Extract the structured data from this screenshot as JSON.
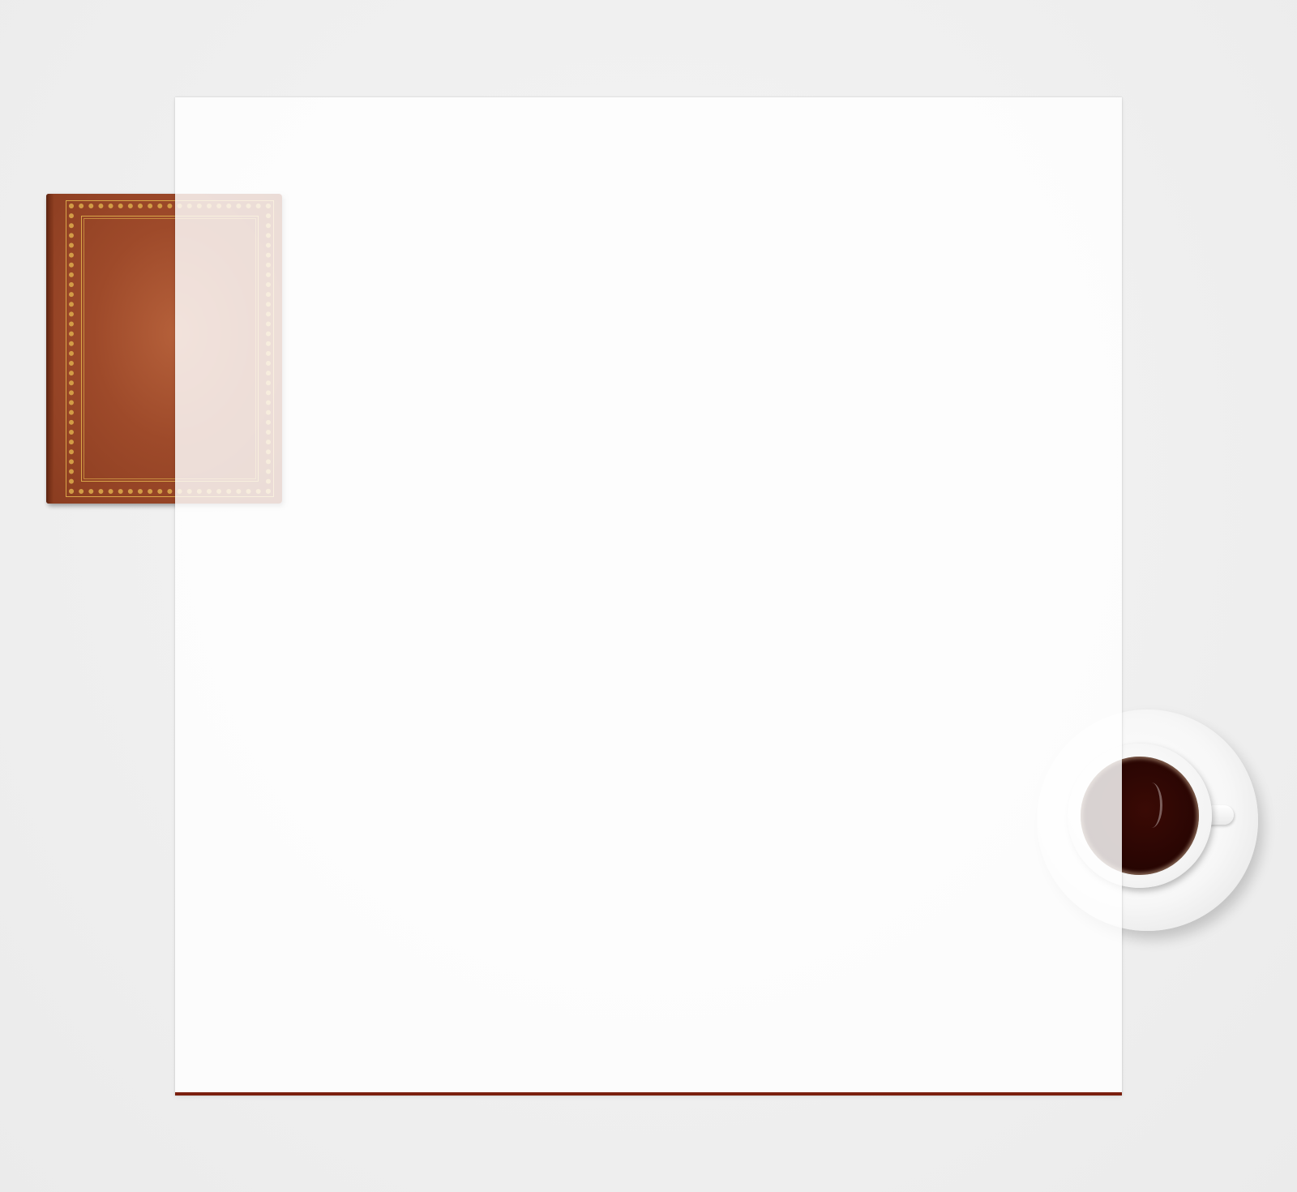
{
  "scene": {
    "background_color": "#f1f1f1",
    "paper_color": "#ffffff",
    "paper_rule_color": "#7a1f0e",
    "book_color": "#9e4a2a",
    "book_ornament_color": "#d9a64a",
    "coffee_color": "#2a0603"
  },
  "icons": {
    "book": "leather-book-icon",
    "cup": "coffee-cup-icon"
  }
}
